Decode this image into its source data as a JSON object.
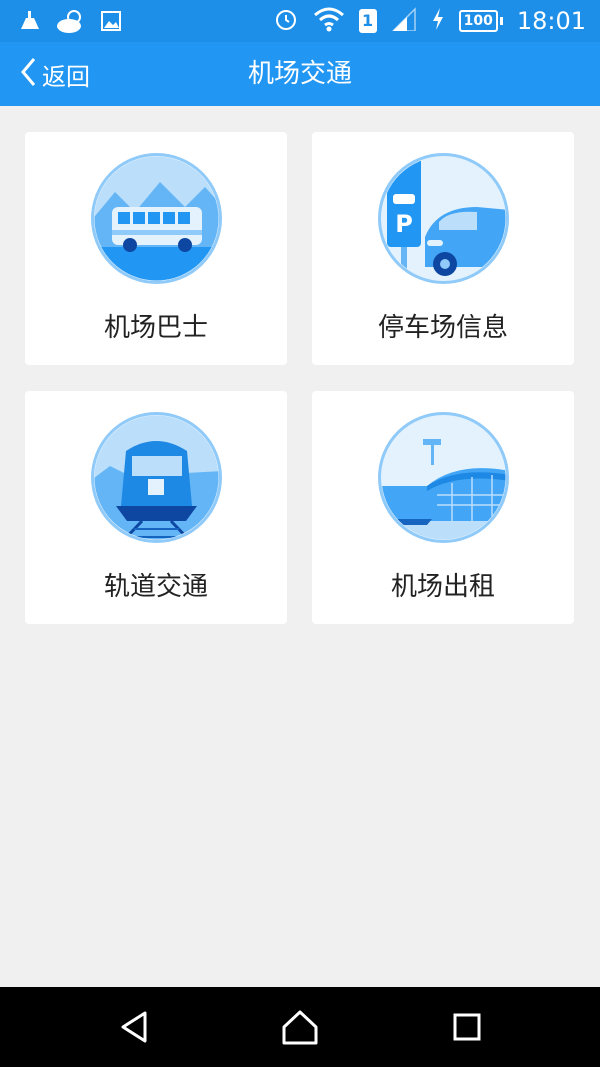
{
  "status_bar": {
    "left_icons": [
      "cleaner-icon",
      "weather-cloudy-icon",
      "image-icon"
    ],
    "right_icons": [
      "alarm-icon",
      "wifi-icon",
      "sim-icon",
      "signal-icon",
      "charging-icon",
      "battery-icon"
    ],
    "sim": "1",
    "battery": "100",
    "time": "18:01"
  },
  "header": {
    "back_label": "返回",
    "title": "机场交通"
  },
  "tiles": [
    {
      "label": "机场巴士",
      "icon": "bus-icon"
    },
    {
      "label": "停车场信息",
      "icon": "parking-car-icon"
    },
    {
      "label": "轨道交通",
      "icon": "train-icon"
    },
    {
      "label": "机场出租",
      "icon": "airport-terminal-icon"
    }
  ],
  "nav_bar": {
    "buttons": [
      "back-triangle-icon",
      "home-icon",
      "recent-apps-icon"
    ]
  },
  "colors": {
    "status_bar": "#1d8fe8",
    "title_bar": "#2196f3",
    "background": "#f0f0f0",
    "icon_blue": "#2196f3"
  }
}
